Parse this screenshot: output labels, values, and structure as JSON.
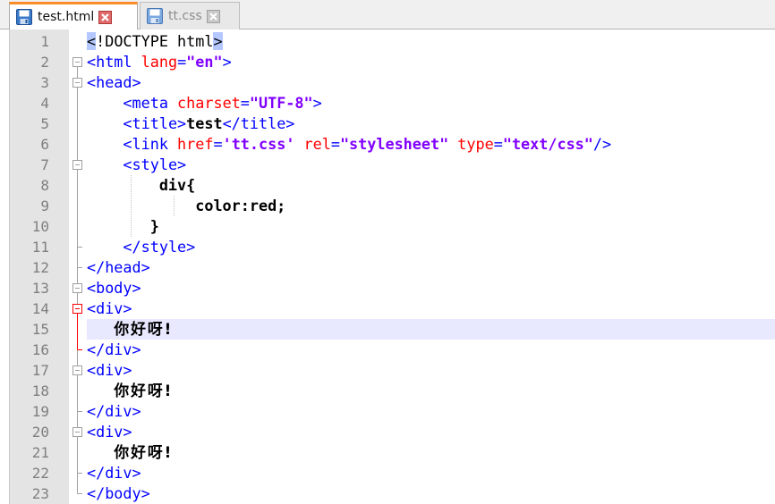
{
  "tabs": [
    {
      "label": "test.html",
      "active": true,
      "icon": "save-icon",
      "close_icon": "close-icon"
    },
    {
      "label": "tt.css",
      "active": false,
      "icon": "save-icon",
      "close_icon": "close-icon"
    }
  ],
  "colors": {
    "tab_accent": "#fa8c28",
    "tag": "#0000ff",
    "attribute": "#ff0000",
    "value": "#8000ff",
    "current_line": "#e8e8ff",
    "fold_marker": "#ff0000"
  },
  "editor": {
    "current_line": 15,
    "lines": [
      {
        "n": "1",
        "parts": [
          {
            "t": "<",
            "c": "doc"
          },
          {
            "t": "!DOCTYPE html",
            "c": "doc"
          },
          {
            "t": ">",
            "c": "doc"
          }
        ]
      },
      {
        "n": "2",
        "parts": [
          {
            "t": "<html",
            "c": "tag"
          },
          {
            "t": " lang",
            "c": "attr"
          },
          {
            "t": "=",
            "c": "tag"
          },
          {
            "t": "\"en\"",
            "c": "val"
          },
          {
            "t": ">",
            "c": "tag"
          }
        ]
      },
      {
        "n": "3",
        "parts": [
          {
            "t": "<head>",
            "c": "tag"
          }
        ]
      },
      {
        "n": "4",
        "parts": [
          {
            "t": "    "
          },
          {
            "t": "<meta",
            "c": "tag"
          },
          {
            "t": " charset",
            "c": "attr"
          },
          {
            "t": "=",
            "c": "tag"
          },
          {
            "t": "\"UTF-8\"",
            "c": "val"
          },
          {
            "t": ">",
            "c": "tag"
          }
        ]
      },
      {
        "n": "5",
        "parts": [
          {
            "t": "    "
          },
          {
            "t": "<title>",
            "c": "tag"
          },
          {
            "t": "test",
            "c": "txt"
          },
          {
            "t": "</title>",
            "c": "tag"
          }
        ]
      },
      {
        "n": "6",
        "parts": [
          {
            "t": "    "
          },
          {
            "t": "<link",
            "c": "tag"
          },
          {
            "t": " href",
            "c": "attr"
          },
          {
            "t": "=",
            "c": "tag"
          },
          {
            "t": "'tt.css'",
            "c": "val"
          },
          {
            "t": " rel",
            "c": "attr"
          },
          {
            "t": "=",
            "c": "tag"
          },
          {
            "t": "\"stylesheet\"",
            "c": "val"
          },
          {
            "t": " type",
            "c": "attr"
          },
          {
            "t": "=",
            "c": "tag"
          },
          {
            "t": "\"text/css\"",
            "c": "val"
          },
          {
            "t": "/>",
            "c": "tag"
          }
        ]
      },
      {
        "n": "7",
        "parts": [
          {
            "t": "    "
          },
          {
            "t": "<style>",
            "c": "tag"
          }
        ]
      },
      {
        "n": "8",
        "parts": [
          {
            "t": "        "
          },
          {
            "t": "div{",
            "c": "txt"
          }
        ]
      },
      {
        "n": "9",
        "parts": [
          {
            "t": "            "
          },
          {
            "t": "color:red;",
            "c": "txt"
          }
        ]
      },
      {
        "n": "10",
        "parts": [
          {
            "t": "       "
          },
          {
            "t": "}",
            "c": "txt"
          }
        ]
      },
      {
        "n": "11",
        "parts": [
          {
            "t": "    "
          },
          {
            "t": "</style>",
            "c": "tag"
          }
        ]
      },
      {
        "n": "12",
        "parts": [
          {
            "t": "</head>",
            "c": "tag"
          }
        ]
      },
      {
        "n": "13",
        "parts": [
          {
            "t": "<body>",
            "c": "tag"
          }
        ]
      },
      {
        "n": "14",
        "parts": [
          {
            "t": "<div>",
            "c": "tag"
          }
        ]
      },
      {
        "n": "15",
        "parts": [
          {
            "t": "   "
          },
          {
            "t": "你好呀!",
            "c": "cjk"
          }
        ]
      },
      {
        "n": "16",
        "parts": [
          {
            "t": "</div>",
            "c": "tag"
          }
        ]
      },
      {
        "n": "17",
        "parts": [
          {
            "t": "<div>",
            "c": "tag"
          }
        ]
      },
      {
        "n": "18",
        "parts": [
          {
            "t": "   "
          },
          {
            "t": "你好呀!",
            "c": "cjk"
          }
        ]
      },
      {
        "n": "19",
        "parts": [
          {
            "t": "</div>",
            "c": "tag"
          }
        ]
      },
      {
        "n": "20",
        "parts": [
          {
            "t": "<div>",
            "c": "tag"
          }
        ]
      },
      {
        "n": "21",
        "parts": [
          {
            "t": "   "
          },
          {
            "t": "你好呀!",
            "c": "cjk"
          }
        ]
      },
      {
        "n": "22",
        "parts": [
          {
            "t": "</div>",
            "c": "tag"
          }
        ]
      },
      {
        "n": "23",
        "parts": [
          {
            "t": "</body>",
            "c": "tag"
          }
        ]
      }
    ]
  }
}
